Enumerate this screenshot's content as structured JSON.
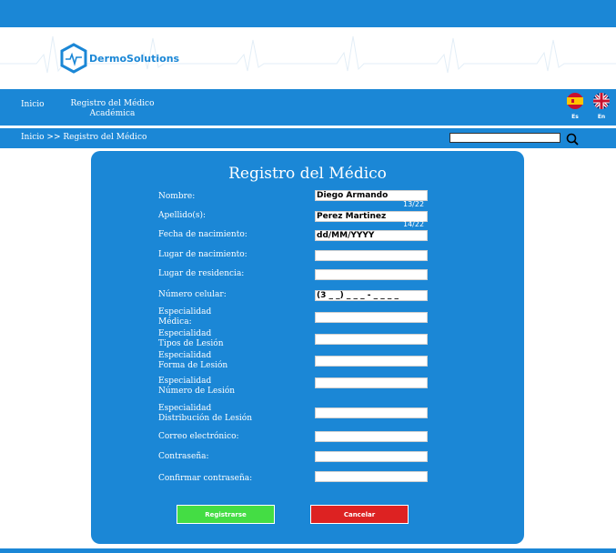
{
  "brand": {
    "name_prefix": "Dermo",
    "name_suffix": "Solutions"
  },
  "nav": {
    "home": "Inicio",
    "registro_line1": "Registro del Médico",
    "registro_line2": "Académica",
    "lang_es": "Es",
    "lang_en": "En"
  },
  "breadcrumb": "Inicio  >> Registro del Médico",
  "search": {
    "value": ""
  },
  "form": {
    "title": "Registro del Médico",
    "fields": [
      {
        "label": "Nombre:",
        "value": "Diego Armando",
        "counter": "13/22"
      },
      {
        "label": "Apellido(s):",
        "value": "Perez Martinez",
        "counter": "14/22"
      },
      {
        "label": "Fecha de nacimiento:",
        "value": "dd/MM/YYYY"
      },
      {
        "label": "Lugar de nacimiento:",
        "value": ""
      },
      {
        "label": "Lugar de residencia:",
        "value": ""
      },
      {
        "label": "Número celular:",
        "value": "(3 _ _) _ _ _ - _ _ _ _"
      },
      {
        "label_line1": "Especialidad",
        "label_line2": "Médica:",
        "value": ""
      },
      {
        "label_line1": "Especialidad",
        "label_line2": "Tipos de Lesión",
        "value": ""
      },
      {
        "label_line1": "Especialidad",
        "label_line2": "Forma de Lesión",
        "value": ""
      },
      {
        "label_line1": "Especialidad",
        "label_line2": "Número de Lesión",
        "value": ""
      },
      {
        "label_line1": "Especialidad",
        "label_line2": "Distribución de Lesión",
        "value": ""
      },
      {
        "label": "Correo electrónico:",
        "value": ""
      },
      {
        "label": "Contraseña:",
        "value": ""
      },
      {
        "label": "Confirmar contraseña:",
        "value": ""
      }
    ],
    "submit_label": "Registrarse",
    "cancel_label": "Cancelar"
  },
  "colors": {
    "primary": "#1b87d6",
    "submit": "#44dd44",
    "cancel": "#dd2222"
  },
  "icons": [
    "heart-pulse-logo-icon",
    "spain-flag-icon",
    "uk-flag-icon",
    "search-icon"
  ]
}
